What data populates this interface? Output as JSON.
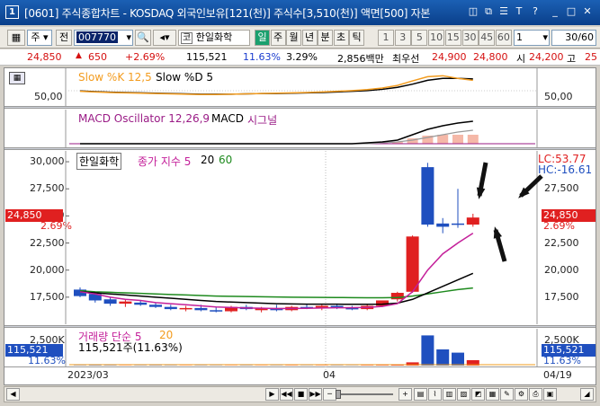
{
  "window": {
    "num": "1",
    "title": "[0601] 주식종합차트 - KOSDAQ 외국인보유[121(천)] 주식수[3,510(천)] 액면[500] 자본",
    "icons": [
      "window-icon",
      "copy-icon",
      "list-icon",
      "text-icon",
      "help-icon",
      "minimize-icon",
      "maximize-icon",
      "close-icon"
    ]
  },
  "toolbar": {
    "market": "주",
    "prefix": "전",
    "code": "007770",
    "stock_name": "한일화학",
    "periods": [
      "일",
      "주",
      "월",
      "년",
      "분",
      "초",
      "틱"
    ],
    "active_period": "일",
    "intervals": [
      "1",
      "3",
      "5",
      "10",
      "15",
      "30",
      "45",
      "60"
    ],
    "unit_value": "1",
    "count_value": "30/60"
  },
  "quote": {
    "price": "24,850",
    "change": "650",
    "change_pct": "+2.69%",
    "volume": "115,521",
    "volume_pct": "11.63%",
    "turnover": "3.29%",
    "amount": "2,856백만",
    "best_label": "최우선",
    "ask": "24,900",
    "bid": "24,800",
    "open_label": "시",
    "open": "24,200",
    "high_label": "고",
    "high": "25"
  },
  "stochastic": {
    "label1": "Slow %K 12,5",
    "label2": "Slow %D 5",
    "axis": "50,00",
    "color_k": "#f39c1f",
    "color_d": "#000000"
  },
  "macd": {
    "label1": "MACD Oscillator 12,26,9",
    "label2": "MACD",
    "label3": "시그널",
    "color_osc": "#9a1b86",
    "color_bar": "#f5b8a8"
  },
  "price_panel": {
    "stock": "한일화학",
    "ma_label": "종가 지수 5",
    "ma2": "20",
    "ma3": "60",
    "lc": "LC:53.77",
    "hc": "HC:-16.61",
    "left_ticks": [
      "30,000",
      "27,500",
      "25,000",
      "22,500",
      "20,000",
      "17,500"
    ],
    "right_ticks": [
      "27,500",
      "25,000",
      "22,500",
      "20,000",
      "17,500"
    ],
    "badge_price": "24,850",
    "badge_pct": "2.69%",
    "colors": {
      "up": "#e02020",
      "down": "#1f4fbf",
      "ma5": "#c4209a",
      "ma20": "#000000",
      "ma60": "#1e8a1e"
    }
  },
  "volume_panel": {
    "label": "거래량 단순 5",
    "ma": "20",
    "value_text": "115,521주(11.63%)",
    "axis_left": "2,500K",
    "axis_right": "2,500K",
    "badge_vol": "115,521",
    "badge_pct": "11.63%"
  },
  "date_axis": {
    "left": "2023/03",
    "mid": "04",
    "right": "04/19"
  },
  "chart_data": {
    "type": "candlestick",
    "ylim": [
      15000,
      31000
    ],
    "candles": [
      {
        "o": 18200,
        "h": 18400,
        "l": 17500,
        "c": 17600
      },
      {
        "o": 17800,
        "h": 18000,
        "l": 17000,
        "c": 17200
      },
      {
        "o": 17300,
        "h": 17500,
        "l": 16700,
        "c": 16900
      },
      {
        "o": 16900,
        "h": 17300,
        "l": 16600,
        "c": 17100
      },
      {
        "o": 17000,
        "h": 17200,
        "l": 16700,
        "c": 16800
      },
      {
        "o": 16800,
        "h": 17000,
        "l": 16500,
        "c": 16600
      },
      {
        "o": 16600,
        "h": 16800,
        "l": 16300,
        "c": 16400
      },
      {
        "o": 16400,
        "h": 16700,
        "l": 16200,
        "c": 16500
      },
      {
        "o": 16500,
        "h": 16800,
        "l": 16200,
        "c": 16300
      },
      {
        "o": 16300,
        "h": 16600,
        "l": 16100,
        "c": 16200
      },
      {
        "o": 16200,
        "h": 16700,
        "l": 16100,
        "c": 16600
      },
      {
        "o": 16600,
        "h": 16800,
        "l": 16300,
        "c": 16400
      },
      {
        "o": 16300,
        "h": 16600,
        "l": 16100,
        "c": 16500
      },
      {
        "o": 16500,
        "h": 16800,
        "l": 16200,
        "c": 16300
      },
      {
        "o": 16300,
        "h": 16700,
        "l": 16200,
        "c": 16600
      },
      {
        "o": 16600,
        "h": 16900,
        "l": 16400,
        "c": 16500
      },
      {
        "o": 16500,
        "h": 16800,
        "l": 16300,
        "c": 16700
      },
      {
        "o": 16700,
        "h": 16900,
        "l": 16400,
        "c": 16500
      },
      {
        "o": 16500,
        "h": 16700,
        "l": 16300,
        "c": 16400
      },
      {
        "o": 16400,
        "h": 16800,
        "l": 16300,
        "c": 16700
      },
      {
        "o": 16700,
        "h": 17100,
        "l": 16600,
        "c": 17200
      },
      {
        "o": 17300,
        "h": 18000,
        "l": 17100,
        "c": 17900
      },
      {
        "o": 18000,
        "h": 23200,
        "l": 17900,
        "c": 23100
      },
      {
        "o": 29500,
        "h": 29900,
        "l": 24000,
        "c": 24200
      },
      {
        "o": 24300,
        "h": 24800,
        "l": 23400,
        "c": 24000
      },
      {
        "o": 24300,
        "h": 27500,
        "l": 23900,
        "c": 24200
      },
      {
        "o": 24200,
        "h": 25200,
        "l": 24000,
        "c": 24850
      }
    ],
    "ma5": [
      18000,
      17800,
      17500,
      17300,
      17200,
      17000,
      16900,
      16800,
      16700,
      16600,
      16550,
      16500,
      16480,
      16450,
      16460,
      16470,
      16500,
      16520,
      16530,
      16550,
      16650,
      16900,
      18000,
      20000,
      21500,
      22500,
      23400
    ],
    "ma20": [
      18000,
      17900,
      17800,
      17700,
      17600,
      17500,
      17400,
      17300,
      17200,
      17100,
      17050,
      17000,
      16950,
      16900,
      16880,
      16860,
      16850,
      16850,
      16840,
      16840,
      16860,
      16950,
      17300,
      17900,
      18500,
      19100,
      19700
    ],
    "ma60": [
      18100,
      18000,
      17950,
      17900,
      17850,
      17800,
      17750,
      17700,
      17650,
      17600,
      17580,
      17560,
      17540,
      17520,
      17500,
      17490,
      17480,
      17470,
      17460,
      17450,
      17450,
      17470,
      17600,
      17800,
      18000,
      18200,
      18350
    ],
    "volumes": [
      20,
      30,
      25,
      15,
      20,
      25,
      20,
      15,
      20,
      18,
      15,
      20,
      15,
      18,
      20,
      15,
      18,
      20,
      15,
      25,
      30,
      40,
      300,
      2800,
      1500,
      1200,
      500
    ],
    "volume_up": [
      false,
      false,
      false,
      true,
      false,
      false,
      false,
      true,
      false,
      false,
      true,
      false,
      true,
      false,
      true,
      false,
      true,
      false,
      false,
      true,
      true,
      true,
      true,
      false,
      false,
      false,
      true
    ]
  }
}
